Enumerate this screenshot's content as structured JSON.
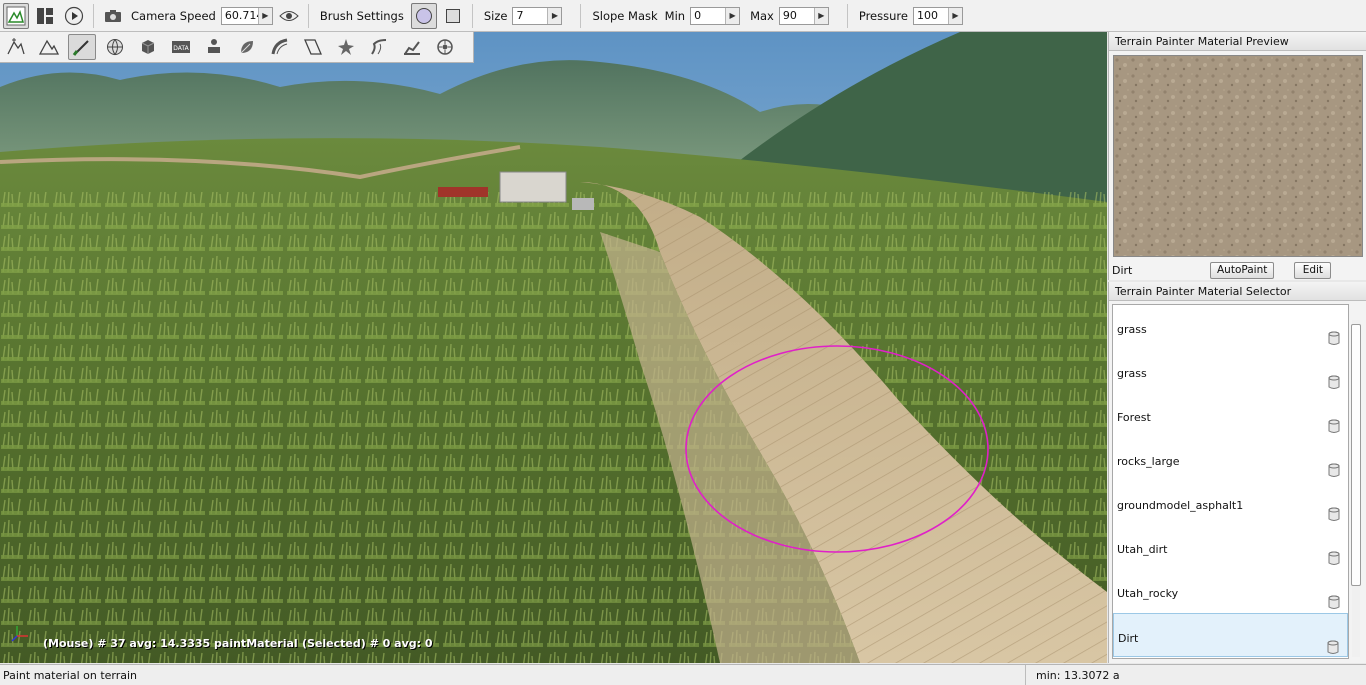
{
  "toolbar": {
    "camera_speed_label": "Camera Speed",
    "camera_speed_value": "60.714",
    "brush_settings_label": "Brush Settings",
    "size_label": "Size",
    "size_value": "7",
    "slope_mask_label": "Slope Mask",
    "min_label": "Min",
    "min_value": "0",
    "max_label": "Max",
    "max_value": "90",
    "pressure_label": "Pressure",
    "pressure_value": "100"
  },
  "tools": [
    "terrain-nav-icon",
    "terrain-editor-icon",
    "terrain-painter-icon",
    "globe-icon",
    "cube-icon",
    "data-icon",
    "actor-icon",
    "leaf-icon",
    "road-icon",
    "decal-icon",
    "sun-icon",
    "river-icon",
    "mesh-road-icon",
    "camera-path-icon"
  ],
  "viewport": {
    "mouse_stat": "(Mouse) # 37  avg: 14.3335 paintMaterial",
    "selected_stat": "(Selected) # 0  avg: 0"
  },
  "preview": {
    "title": "Terrain Painter Material Preview",
    "material_name": "Dirt",
    "autopaint_label": "AutoPaint",
    "edit_label": "Edit"
  },
  "selector": {
    "title": "Terrain Painter Material Selector",
    "materials": [
      {
        "name": "grass"
      },
      {
        "name": "grass"
      },
      {
        "name": "Forest"
      },
      {
        "name": "rocks_large"
      },
      {
        "name": "groundmodel_asphalt1"
      },
      {
        "name": "Utah_dirt"
      },
      {
        "name": "Utah_rocky"
      },
      {
        "name": "Dirt",
        "selected": true
      }
    ]
  },
  "status": {
    "left": "Paint material on terrain",
    "right": "min: 13.3072  a"
  },
  "colors": {
    "brush_ring": "#e020c8",
    "selected_row": "#e3f1fb"
  }
}
